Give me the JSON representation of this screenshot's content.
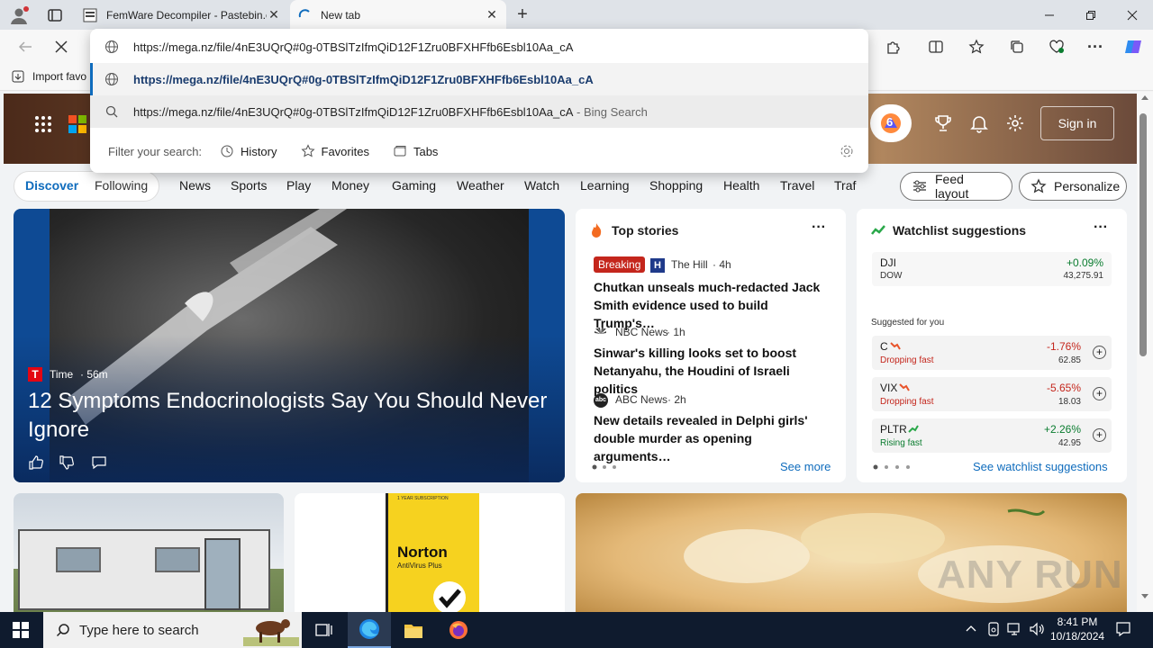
{
  "tabs": [
    {
      "title": "FemWare Decompiler - Pastebin.com",
      "icon": "pastebin-icon"
    },
    {
      "title": "New tab",
      "icon": "loading-icon"
    }
  ],
  "address": {
    "value": "https://mega.nz/file/4nE3UQrQ#0g-0TBSlTzIfmQiD12F1Zru0BFXHFfb6Esbl10Aa_cA"
  },
  "omnibox": {
    "suggestion1": "https://mega.nz/file/4nE3UQrQ#0g-0TBSlTzIfmQiD12F1Zru0BFXHFfb6Esbl10Aa_cA",
    "suggestion2": "https://mega.nz/file/4nE3UQrQ#0g-0TBSlTzIfmQiD12F1Zru0BFXHFfb6Esbl10Aa_cA",
    "suggestion2_suffix": " - Bing Search",
    "filter_label": "Filter your search:",
    "filters": [
      "History",
      "Favorites",
      "Tabs"
    ]
  },
  "favbar": {
    "import_label": "Import favo"
  },
  "header": {
    "sign_in": "Sign in",
    "notification_count": "6"
  },
  "nav": {
    "discover": "Discover",
    "following": "Following",
    "items": [
      "News",
      "Sports",
      "Play",
      "Money",
      "Gaming",
      "Weather",
      "Watch",
      "Learning",
      "Shopping",
      "Health",
      "Travel",
      "Traf"
    ],
    "feed_layout": "Feed layout",
    "personalize": "Personalize"
  },
  "hero": {
    "source": "Time",
    "time": "· 56m",
    "title": "12 Symptoms Endocrinologists Say You Should Never Ignore"
  },
  "top_stories": {
    "title": "Top stories",
    "items": [
      {
        "badge": "Breaking",
        "source": "The Hill",
        "time": "· 4h",
        "headline": "Chutkan unseals much-redacted Jack Smith evidence used to build Trump's…"
      },
      {
        "source": "NBC News",
        "time": "· 1h",
        "headline": "Sinwar's killing looks set to boost Netanyahu, the Houdini of Israeli politics"
      },
      {
        "source": "ABC News",
        "time": "· 2h",
        "headline": "New details revealed in Delphi girls' double murder as opening arguments…"
      }
    ],
    "see_more": "See more"
  },
  "watchlist": {
    "title": "Watchlist suggestions",
    "suggested_label": "Suggested for you",
    "see_link": "See watchlist suggestions",
    "stocks": [
      {
        "symbol": "DJI",
        "name": "DOW",
        "change": "+0.09%",
        "price": "43,275.91",
        "color": "#0a7c2f"
      },
      {
        "symbol": "C",
        "name": "Dropping fast",
        "change": "-1.76%",
        "price": "62.85",
        "color": "#c4261c"
      },
      {
        "symbol": "VIX",
        "name": "Dropping fast",
        "change": "-5.65%",
        "price": "18.03",
        "color": "#c4261c"
      },
      {
        "symbol": "PLTR",
        "name": "Rising fast",
        "change": "+2.26%",
        "price": "42.95",
        "color": "#0a7c2f"
      }
    ]
  },
  "ads": {
    "norton_subscription": "1 YEAR SUBSCRIPTION",
    "norton_title": "Norton",
    "norton_sub": "AntiVirus Plus"
  },
  "watermark": "ANY RUN",
  "taskbar": {
    "search_placeholder": "Type here to search",
    "time": "8:41 PM",
    "date": "10/18/2024"
  },
  "colors": {
    "accent": "#0f6cbd",
    "breaking": "#c4261c",
    "taskbar": "#0f1b2e"
  }
}
